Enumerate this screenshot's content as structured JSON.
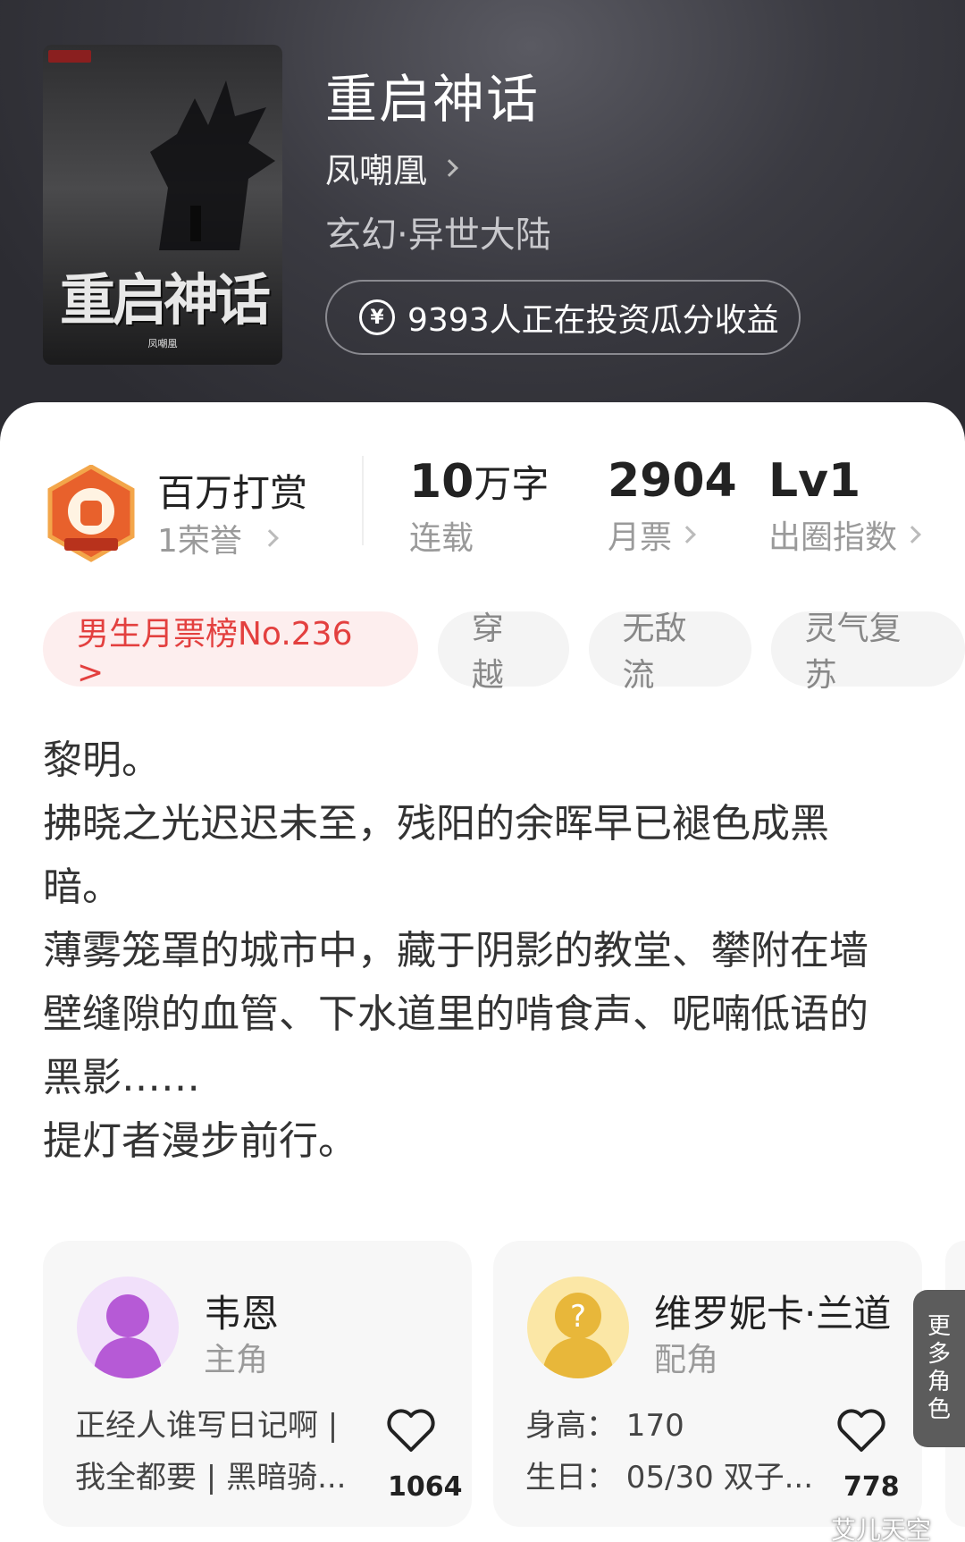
{
  "book": {
    "title": "重启神话",
    "author": "凤嘲凰",
    "genre": "玄幻·异世大陆",
    "invest_text": "9393人正在投资瓜分收益",
    "invest_icon": "yen-coin-icon",
    "cover": {
      "title": "重启神话",
      "author": "凤嘲凰"
    }
  },
  "stats": {
    "reward_title": "百万打赏",
    "reward_sub": "1荣誉",
    "words_value": "10",
    "words_unit": "万字",
    "words_label": "连载",
    "tickets_value": "2904",
    "tickets_label": "月票",
    "level_value": "Lv1",
    "level_label": "出圈指数"
  },
  "tags": {
    "rank": "男生月票榜No.236 >",
    "items": [
      "穿越",
      "无敌流",
      "灵气复苏"
    ]
  },
  "synopsis": [
    "黎明。",
    "拂晓之光迟迟未至，残阳的余晖早已褪色成黑暗。",
    "薄雾笼罩的城市中，藏于阴影的教堂、攀附在墙壁缝隙的血管、下水道里的啃食声、呢喃低语的黑影……",
    "提灯者漫步前行。"
  ],
  "characters": [
    {
      "name": "韦恩",
      "role": "主角",
      "line1": "正经人谁写日记啊 |",
      "line2": "我全都要 | 黑暗骑...",
      "likes": "1064"
    },
    {
      "name": "维罗妮卡·兰道",
      "role": "配角",
      "line1": "身高：  170",
      "line2": "生日：  05/30 双子...",
      "likes": "778"
    }
  ],
  "more_roles": "更多角色",
  "watermark": "艾儿天空",
  "colors": {
    "hero_bg": "#3b3b42",
    "rank_tag_bg": "#fdeeee",
    "rank_tag_text": "#e3403f",
    "accent_orange": "#e8612c"
  }
}
